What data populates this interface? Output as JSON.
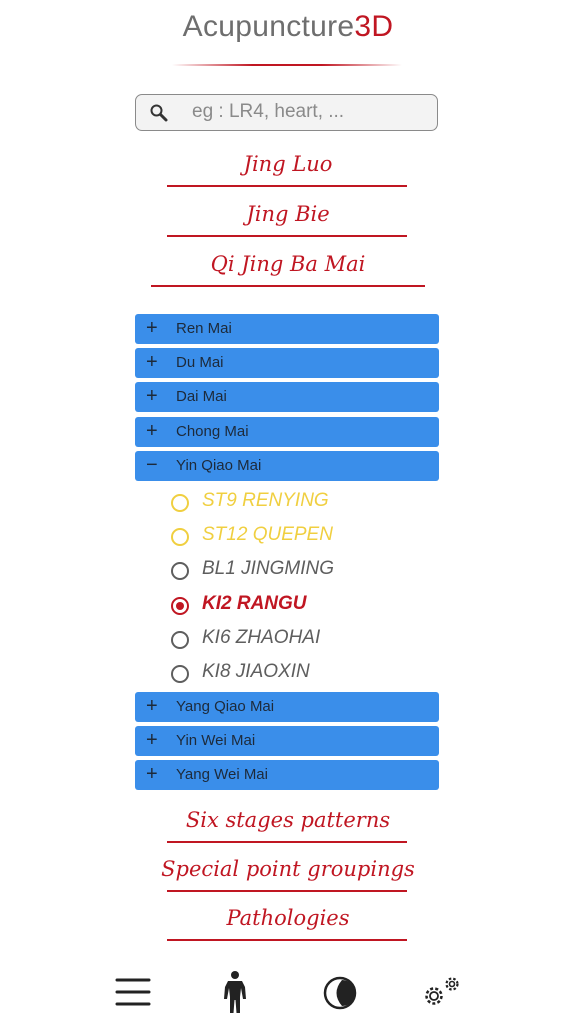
{
  "app": {
    "title_main": "Acupuncture",
    "title_accent": "3D",
    "accent_color": "#c01622"
  },
  "search": {
    "placeholder": "eg : LR4, heart, ..."
  },
  "top_links": [
    {
      "label": "Jing Luo"
    },
    {
      "label": "Jing Bie"
    },
    {
      "label": "Qi Jing Ba Mai"
    }
  ],
  "vessels": [
    {
      "label": "Ren Mai",
      "expanded": false
    },
    {
      "label": "Du Mai",
      "expanded": false
    },
    {
      "label": "Dai Mai",
      "expanded": false
    },
    {
      "label": "Chong Mai",
      "expanded": false
    },
    {
      "label": "Yin Qiao Mai",
      "expanded": true
    },
    {
      "label": "Yang Qiao Mai",
      "expanded": false
    },
    {
      "label": "Yin Wei Mai",
      "expanded": false
    },
    {
      "label": "Yang Wei Mai",
      "expanded": false
    }
  ],
  "points": [
    {
      "label": "ST9 RENYING",
      "color": "#f0cf40",
      "selected": false
    },
    {
      "label": "ST12 QUEPEN",
      "color": "#f0cf40",
      "selected": false
    },
    {
      "label": "BL1 JINGMING",
      "color": "#5e5e5e",
      "selected": false
    },
    {
      "label": "KI2 RANGU",
      "color": "#c01622",
      "selected": true
    },
    {
      "label": "KI6 ZHAOHAI",
      "color": "#5e5e5e",
      "selected": false
    },
    {
      "label": "KI8 JIAOXIN",
      "color": "#5e5e5e",
      "selected": false
    }
  ],
  "bottom_links": [
    {
      "label": "Six stages patterns"
    },
    {
      "label": "Special point groupings"
    },
    {
      "label": "Pathologies"
    }
  ],
  "bottom_nav": [
    {
      "icon": "menu-icon"
    },
    {
      "icon": "body-icon"
    },
    {
      "icon": "contrast-icon"
    },
    {
      "icon": "settings-icon"
    }
  ]
}
